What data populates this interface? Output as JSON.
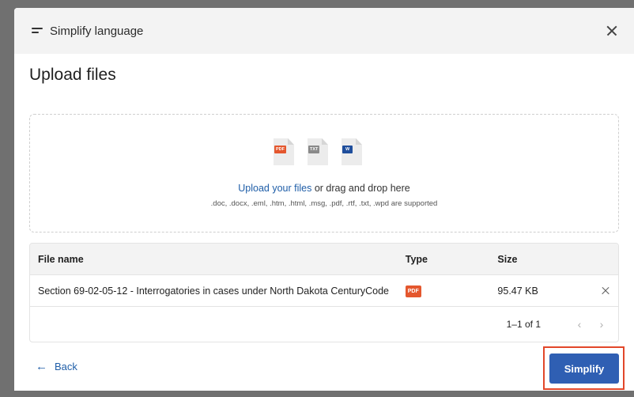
{
  "dialog": {
    "header_title": "Simplify language",
    "page_title": "Upload files"
  },
  "dropzone": {
    "icons": [
      {
        "name": "pdf-file-icon",
        "badge": "PDF"
      },
      {
        "name": "txt-file-icon",
        "badge": "TXT"
      },
      {
        "name": "word-file-icon",
        "badge": "W"
      }
    ],
    "link_text": "Upload your files",
    "rest_text": " or drag and drop here",
    "supported_text": ".doc, .docx, .eml, .htm, .html, .msg, .pdf, .rtf, .txt, .wpd are supported"
  },
  "table": {
    "headers": {
      "name": "File name",
      "type": "Type",
      "size": "Size"
    },
    "rows": [
      {
        "name": "Section 69-02-05-12 - Interrogatories in cases under North Dakota CenturyCode",
        "type_badge": "PDF",
        "size": "95.47 KB"
      }
    ],
    "pagination": {
      "range": "1–1 of 1",
      "prev": "‹",
      "next": "›"
    }
  },
  "footer": {
    "back_label": "Back",
    "back_arrow": "←",
    "primary_label": "Simplify"
  },
  "colors": {
    "accent": "#2f5fb3",
    "link": "#1f5ea8",
    "pdf": "#e4572e",
    "highlight": "#e2472a"
  }
}
